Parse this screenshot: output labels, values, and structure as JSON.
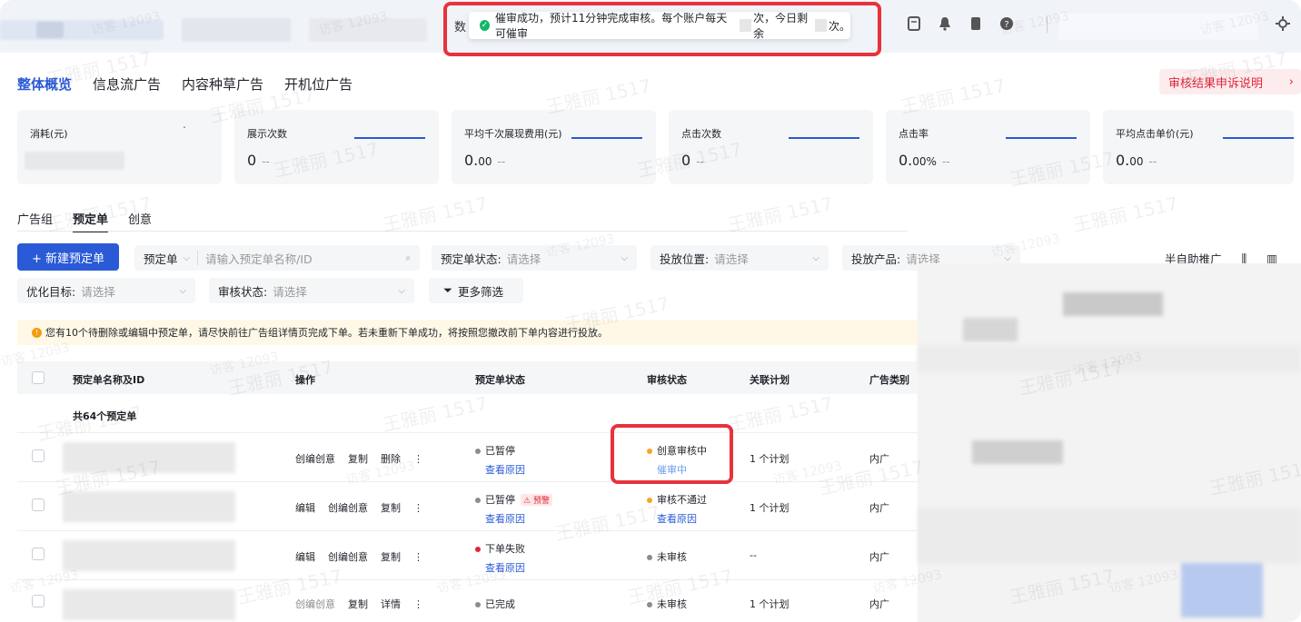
{
  "toast": {
    "prefix_char": "数",
    "text_a": "催审成功，预计11分钟完成审核。每个账户每天可催审",
    "text_b": "次，今日剩余",
    "text_c": "次。"
  },
  "top_tabs": [
    "整体概览",
    "信息流广告",
    "内容种草广告",
    "开机位广告"
  ],
  "appeal": {
    "label": "审核结果申诉说明",
    "arrow": "›"
  },
  "metrics": [
    {
      "label": "消耗(元)",
      "value": "",
      "dash": ""
    },
    {
      "label": "展示次数",
      "value": "0",
      "dash": "--"
    },
    {
      "label": "平均千次展现费用(元)",
      "value": "0.",
      "decimal": "00",
      "dash": "--"
    },
    {
      "label": "点击次数",
      "value": "0",
      "dash": "--"
    },
    {
      "label": "点击率",
      "value": "0.",
      "decimal": "00%",
      "dash": "--"
    },
    {
      "label": "平均点击单价(元)",
      "value": "0.",
      "decimal": "00",
      "dash": "--"
    }
  ],
  "sub_tabs": [
    "广告组",
    "预定单",
    "创意"
  ],
  "filters": {
    "new_button": "+ 新建预定单",
    "search_type": "预定单",
    "search_placeholder": "请输入预定单名称/ID",
    "status_label": "预定单状态:",
    "position_label": "投放位置:",
    "product_label": "投放产品:",
    "goal_label": "优化目标:",
    "audit_label": "审核状态:",
    "placeholder": "请选择",
    "more_filters": "更多筛选",
    "right_label": "半自助推广"
  },
  "notice": "您有10个待删除或编辑中预定单，请尽快前往广告组详情页完成下单。若未重新下单成功，将按照您撤改前下单内容进行投放。",
  "table": {
    "headers": [
      "预定单名称及ID",
      "操作",
      "预定单状态",
      "审核状态",
      "关联计划",
      "广告类别"
    ],
    "total": "共64个预定单",
    "rows": [
      {
        "ops": [
          "创编创意",
          "复制",
          "删除",
          "⋮"
        ],
        "status": "已暂停",
        "status_color": "#8c8c8c",
        "status_link": "查看原因",
        "badge": "",
        "audit": "创意审核中",
        "audit_color": "#f5a623",
        "audit_link": "催审中",
        "plan": "1 个计划",
        "type": "内广"
      },
      {
        "ops": [
          "编辑",
          "创编创意",
          "复制",
          "⋮"
        ],
        "status": "已暂停",
        "status_color": "#8c8c8c",
        "status_link": "查看原因",
        "badge": "预警",
        "audit": "审核不通过",
        "audit_color": "#f5a623",
        "audit_link": "查看原因",
        "plan": "1 个计划",
        "type": "内广"
      },
      {
        "ops": [
          "编辑",
          "创编创意",
          "复制",
          "⋮"
        ],
        "status": "下单失败",
        "status_color": "#e0263a",
        "status_link": "查看原因",
        "badge": "",
        "audit": "未审核",
        "audit_color": "#8c8c8c",
        "audit_link": "",
        "plan": "--",
        "type": "内广"
      },
      {
        "ops": [
          "创编创意",
          "复制",
          "详情",
          "⋮"
        ],
        "status": "已完成",
        "status_color": "#8c8c8c",
        "status_link": "",
        "badge": "",
        "audit": "未审核",
        "audit_color": "#8c8c8c",
        "audit_link": "",
        "plan": "1 个计划",
        "type": "内广"
      }
    ]
  },
  "watermark": {
    "name": "王雅丽 1517",
    "visitor": "访客 12093"
  },
  "colors": {
    "accent": "#2a5ad6",
    "danger": "#e0263a",
    "highlight": "#e8323c"
  }
}
